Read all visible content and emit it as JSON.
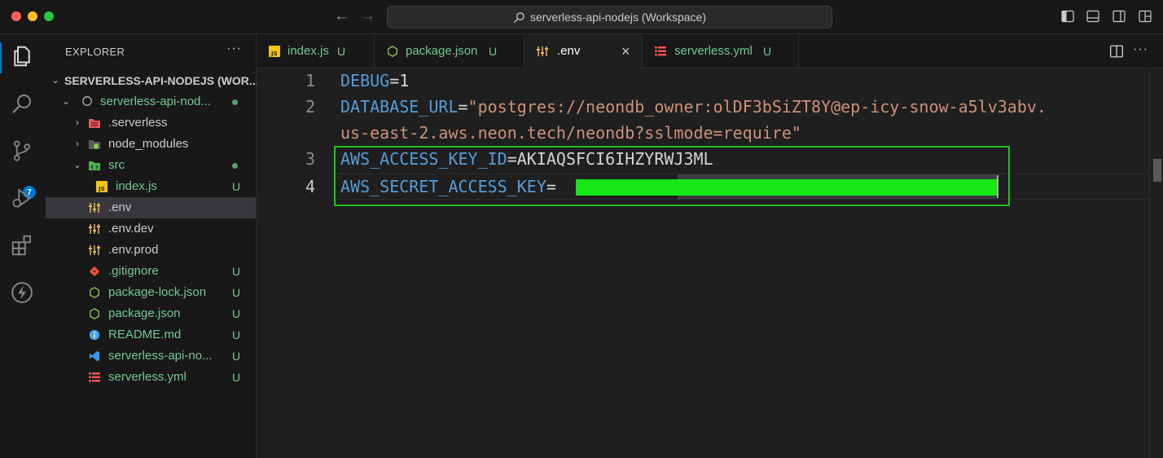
{
  "window": {
    "title": "serverless-api-nodejs (Workspace)"
  },
  "activity": {
    "scm_badge": "7"
  },
  "explorer": {
    "header": "EXPLORER",
    "more": "···",
    "workspace_label": "SERVERLESS-API-NODEJS (WOR...",
    "project_folder": "serverless-api-nod...",
    "items": [
      {
        "name": ".serverless",
        "status": ""
      },
      {
        "name": "node_modules",
        "status": ""
      },
      {
        "name": "src",
        "status": ""
      },
      {
        "name": "index.js",
        "status": "U"
      },
      {
        "name": ".env",
        "status": ""
      },
      {
        "name": ".env.dev",
        "status": ""
      },
      {
        "name": ".env.prod",
        "status": ""
      },
      {
        "name": ".gitignore",
        "status": "U"
      },
      {
        "name": "package-lock.json",
        "status": "U"
      },
      {
        "name": "package.json",
        "status": "U"
      },
      {
        "name": "README.md",
        "status": "U"
      },
      {
        "name": "serverless-api-no...",
        "status": "U"
      },
      {
        "name": "serverless.yml",
        "status": "U"
      }
    ]
  },
  "tabs": [
    {
      "label": "index.js",
      "status": "U"
    },
    {
      "label": "package.json",
      "status": "U"
    },
    {
      "label": ".env",
      "status": ""
    },
    {
      "label": "serverless.yml",
      "status": "U"
    }
  ],
  "editor": {
    "line_numbers": [
      "1",
      "2",
      "3",
      "4"
    ],
    "lines": {
      "l1_key": "DEBUG",
      "l1_eq": "=",
      "l1_val": "1",
      "l2_key": "DATABASE_URL",
      "l2_eq": "=",
      "l2_val_a": "\"postgres://neondb_owner:olDF3bSiZT8Y@ep-icy-snow-a5lv3abv.",
      "l2_val_b": "us-east-2.aws.neon.tech/neondb?sslmode=require\"",
      "l3_key": "AWS_ACCESS_KEY_ID",
      "l3_eq": "=",
      "l3_val": "AKIAQSFCI6IHZYRWJ3ML",
      "l4_key": "AWS_SECRET_ACCESS_KEY",
      "l4_eq": "="
    }
  },
  "colors": {
    "accent": "#0078d4",
    "git_untracked": "#73c991",
    "highlight_box": "#22c022",
    "redaction": "#17e717"
  }
}
